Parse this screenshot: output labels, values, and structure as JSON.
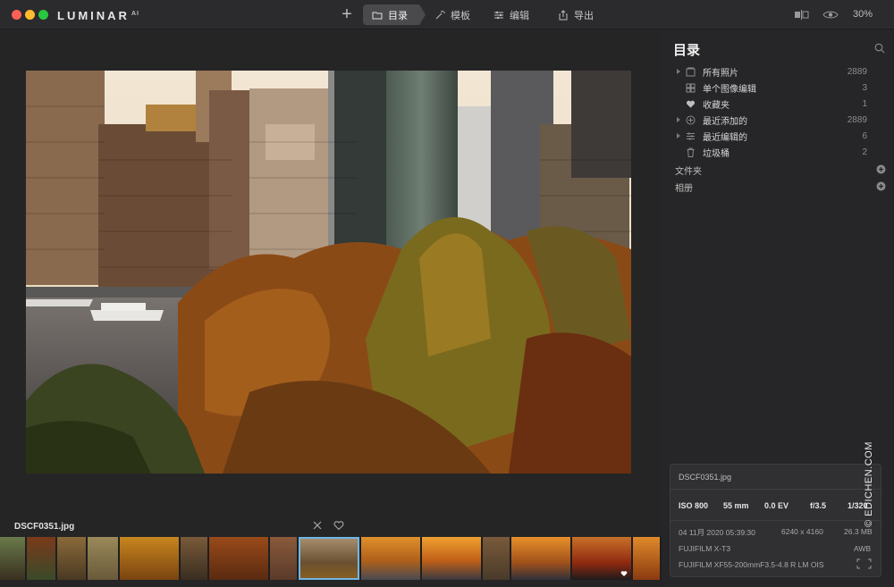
{
  "app": {
    "logo": "LUMINAR",
    "logo_suffix": "AI"
  },
  "toolbar": {
    "tabs": [
      {
        "label": "目录",
        "icon": "folder-icon",
        "active": true
      },
      {
        "label": "模板",
        "icon": "magic-wand-icon",
        "active": false
      },
      {
        "label": "编辑",
        "icon": "sliders-icon",
        "active": false
      },
      {
        "label": "导出",
        "icon": "share-icon",
        "active": false
      }
    ],
    "zoom": "30%"
  },
  "sidebar": {
    "title": "目录",
    "items": [
      {
        "label": "所有照片",
        "count": "2889",
        "icon": "photos-icon",
        "has_arrow": true
      },
      {
        "label": "单个图像编辑",
        "count": "3",
        "icon": "grid-icon",
        "has_arrow": false
      },
      {
        "label": "收藏夹",
        "count": "1",
        "icon": "heart-icon",
        "has_arrow": false
      },
      {
        "label": "最近添加的",
        "count": "2889",
        "icon": "plus-circle-icon",
        "has_arrow": true
      },
      {
        "label": "最近编辑的",
        "count": "6",
        "icon": "sliders-icon",
        "has_arrow": true
      },
      {
        "label": "垃圾桶",
        "count": "2",
        "icon": "trash-icon",
        "has_arrow": false
      }
    ],
    "sections": [
      {
        "label": "文件夹"
      },
      {
        "label": "相册"
      }
    ]
  },
  "filmstrip": {
    "filename": "DSCF0351.jpg",
    "selected_index": 7
  },
  "info": {
    "filename": "DSCF0351.jpg",
    "iso": "ISO 800",
    "focal": "55 mm",
    "ev": "0.0 EV",
    "aperture": "f/3.5",
    "shutter": "1/320",
    "date": "04 11月 2020 05:39:30",
    "dimensions": "6240 x 4160",
    "size": "26.3 MB",
    "camera": "FUJIFILM X-T3",
    "wb": "AWB",
    "lens": "FUJIFILM XF55-200mmF3.5-4.8 R LM OIS"
  },
  "watermark": "© EDICHEN.COM",
  "colors": {
    "accent": "#6fb6e6",
    "background": "#252526",
    "sidebar": "#262628"
  }
}
